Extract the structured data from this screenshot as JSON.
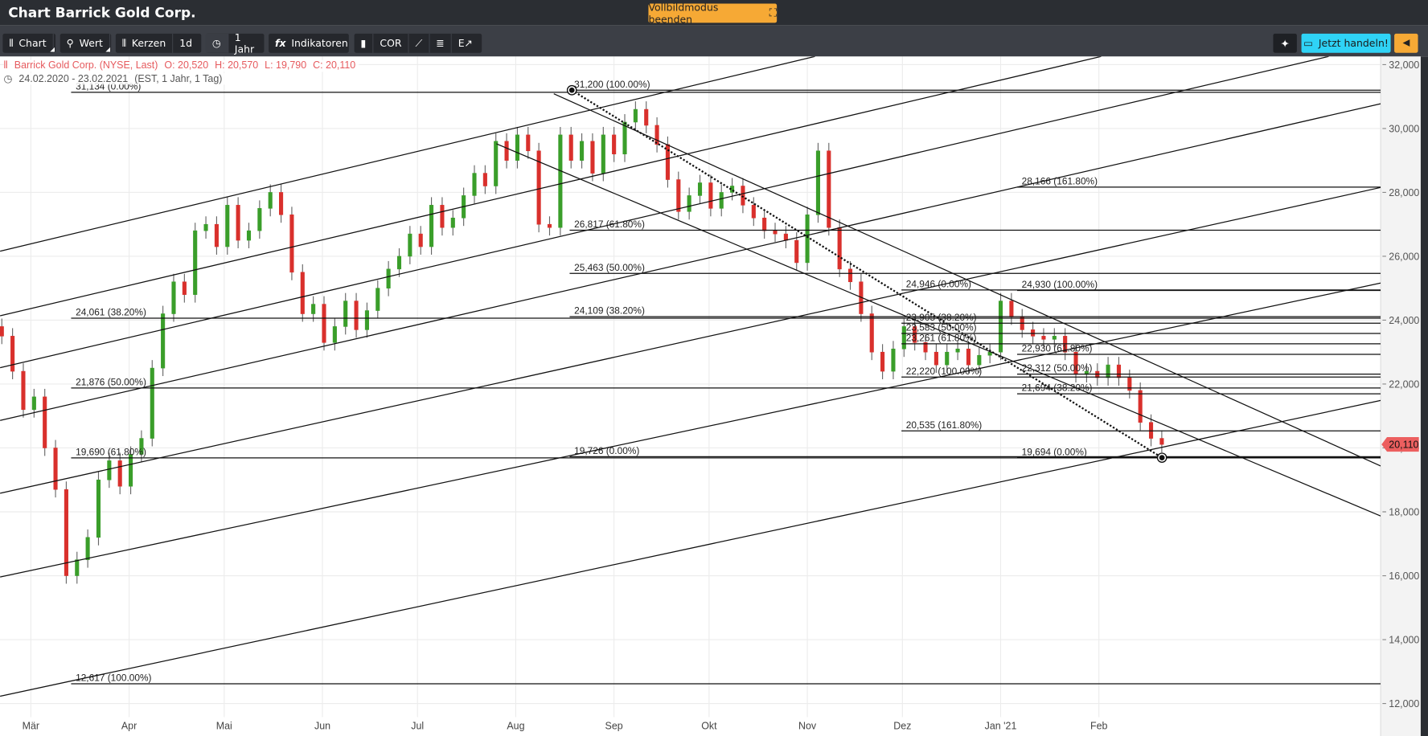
{
  "header": {
    "title": "Chart Barrick Gold Corp.",
    "fullscreen_button": "Vollbildmodus beenden"
  },
  "toolbar": {
    "chart": "Chart",
    "wert": "Wert",
    "kerzen": "Kerzen",
    "interval": "1d",
    "range": "1 Jahr",
    "indikatoren": "Indikatoren",
    "cor": "COR",
    "trade": "Jetzt handeln!"
  },
  "legend": {
    "name": "Barrick Gold Corp. (NYSE, Last)",
    "open": "O: 20,520",
    "high": "H: 20,570",
    "low": "L: 19,790",
    "close": "C: 20,110",
    "range": "24.02.2020 - 23.02.2021",
    "meta": "(EST, 1 Jahr, 1 Tag)"
  },
  "colors": {
    "up": "#3a9e2a",
    "down": "#d9302c",
    "price_tag": "#ec5f5f",
    "accent": "#f6a935",
    "trade": "#2fd3f6"
  },
  "chart_data": {
    "type": "candlestick",
    "title": "Barrick Gold Corp. (NYSE, Last)",
    "ylim": [
      12000,
      32000
    ],
    "day_range": [
      0,
      366
    ],
    "y_ticks": [
      "12,000",
      "14,000",
      "16,000",
      "18,000",
      "20,000",
      "22,000",
      "24,000",
      "26,000",
      "28,000",
      "30,000",
      "32,000"
    ],
    "y_tick_values": [
      12000,
      14000,
      16000,
      18000,
      20000,
      22000,
      24000,
      26000,
      28000,
      30000,
      32000
    ],
    "x_ticks": [
      {
        "label": "Mär",
        "day": 6
      },
      {
        "label": "Apr",
        "day": 37
      },
      {
        "label": "Mai",
        "day": 67
      },
      {
        "label": "Jun",
        "day": 98
      },
      {
        "label": "Jul",
        "day": 128
      },
      {
        "label": "Aug",
        "day": 159
      },
      {
        "label": "Sep",
        "day": 190
      },
      {
        "label": "Okt",
        "day": 220
      },
      {
        "label": "Nov",
        "day": 251
      },
      {
        "label": "Dez",
        "day": 281
      },
      {
        "label": "Jan '21",
        "day": 312
      },
      {
        "label": "Feb",
        "day": 343
      }
    ],
    "first_open": 23800,
    "closes": [
      23500,
      22400,
      21200,
      21600,
      20000,
      18700,
      16000,
      16500,
      17200,
      19000,
      19600,
      18800,
      19800,
      20300,
      22500,
      24200,
      25200,
      24800,
      26800,
      27000,
      26300,
      27600,
      26500,
      26800,
      27500,
      28000,
      27300,
      25500,
      24200,
      24500,
      23300,
      23800,
      24600,
      23700,
      24300,
      25000,
      25600,
      26000,
      26700,
      26300,
      27600,
      26900,
      27200,
      27900,
      28600,
      28200,
      29600,
      29000,
      29800,
      29300,
      27000,
      26900,
      29800,
      29000,
      29600,
      28600,
      29800,
      29200,
      30200,
      30600,
      30100,
      29500,
      28400,
      27400,
      27900,
      28300,
      27500,
      28000,
      28200,
      27600,
      27200,
      26800,
      26700,
      26500,
      25800,
      27300,
      29300,
      26900,
      25600,
      25200,
      24200,
      23000,
      22400,
      23100,
      23800,
      23300,
      23000,
      22600,
      23000,
      23100,
      22600,
      22900,
      23000,
      24600,
      24100,
      23700,
      23500,
      23400,
      23500,
      23000,
      22300,
      22400,
      22200,
      22600,
      22200,
      21800,
      20800,
      20300,
      20110
    ],
    "last_price": "20,110",
    "last_price_value": 20110,
    "trendlines": [
      {
        "d1": -3.7,
        "p1": 26160,
        "d2": 253.4,
        "p2": 32256
      },
      {
        "d1": -3.7,
        "p1": 24137,
        "d2": 343.7,
        "p2": 32256
      },
      {
        "d1": -3.7,
        "p1": 22513,
        "d2": 415.5,
        "p2": 32256
      },
      {
        "d1": -3.7,
        "p1": 20861,
        "d2": 431.9,
        "p2": 30775
      },
      {
        "d1": -3.7,
        "p1": 18581,
        "d2": 431.9,
        "p2": 28154
      },
      {
        "d1": -3.7,
        "p1": 15960,
        "d2": 431.9,
        "p2": 25162
      },
      {
        "d1": -3.7,
        "p1": 12228,
        "d2": 431.9,
        "p2": 21487
      },
      {
        "d1": 171,
        "p1": 31088,
        "d2": 431.9,
        "p2": 19436
      },
      {
        "d1": 152.9,
        "p1": 29521,
        "d2": 431.9,
        "p2": 17869
      }
    ],
    "dotted_line": {
      "d1": 176.7,
      "p1": 31200,
      "d2": 362.9,
      "p2": 19694
    },
    "fib_groups": [
      {
        "start_day": 18.7,
        "levels": [
          {
            "value": 31134,
            "label": "31,134 (0.00%)"
          },
          {
            "value": 24061,
            "label": "24,061 (38.20%)"
          },
          {
            "value": 21876,
            "label": "21,876 (50.00%)"
          },
          {
            "value": 19690,
            "label": "19,690 (61.80%)"
          },
          {
            "value": 12617,
            "label": "12,617 (100.00%)"
          }
        ]
      },
      {
        "start_day": 176,
        "levels": [
          {
            "value": 31200,
            "label": "31,200 (100.00%)"
          },
          {
            "value": 26817,
            "label": "26,817 (61.80%)"
          },
          {
            "value": 25463,
            "label": "25,463 (50.00%)"
          },
          {
            "value": 24109,
            "label": "24,109 (38.20%)"
          },
          {
            "value": 19726,
            "label": "19,726 (0.00%)"
          }
        ]
      },
      {
        "start_day": 280.7,
        "levels": [
          {
            "value": 24946,
            "label": "24,946 (0.00%)"
          },
          {
            "value": 23905,
            "label": "23,905 (38.20%)"
          },
          {
            "value": 23583,
            "label": "23,583 (50.00%)"
          },
          {
            "value": 23261,
            "label": "23,261 (61.80%)"
          },
          {
            "value": 22220,
            "label": "22,220 (100.00%)"
          },
          {
            "value": 20535,
            "label": "20,535 (161.80%)"
          }
        ]
      },
      {
        "start_day": 317.2,
        "levels": [
          {
            "value": 28166,
            "label": "28,166 (161.80%)"
          },
          {
            "value": 24930,
            "label": "24,930 (100.00%)"
          },
          {
            "value": 22930,
            "label": "22,930 (61.80%)"
          },
          {
            "value": 22312,
            "label": "22,312 (50.00%)"
          },
          {
            "value": 21694,
            "label": "21,694 (38.20%)"
          },
          {
            "value": 19694,
            "label": "19,694 (0.00%)"
          }
        ]
      }
    ]
  }
}
